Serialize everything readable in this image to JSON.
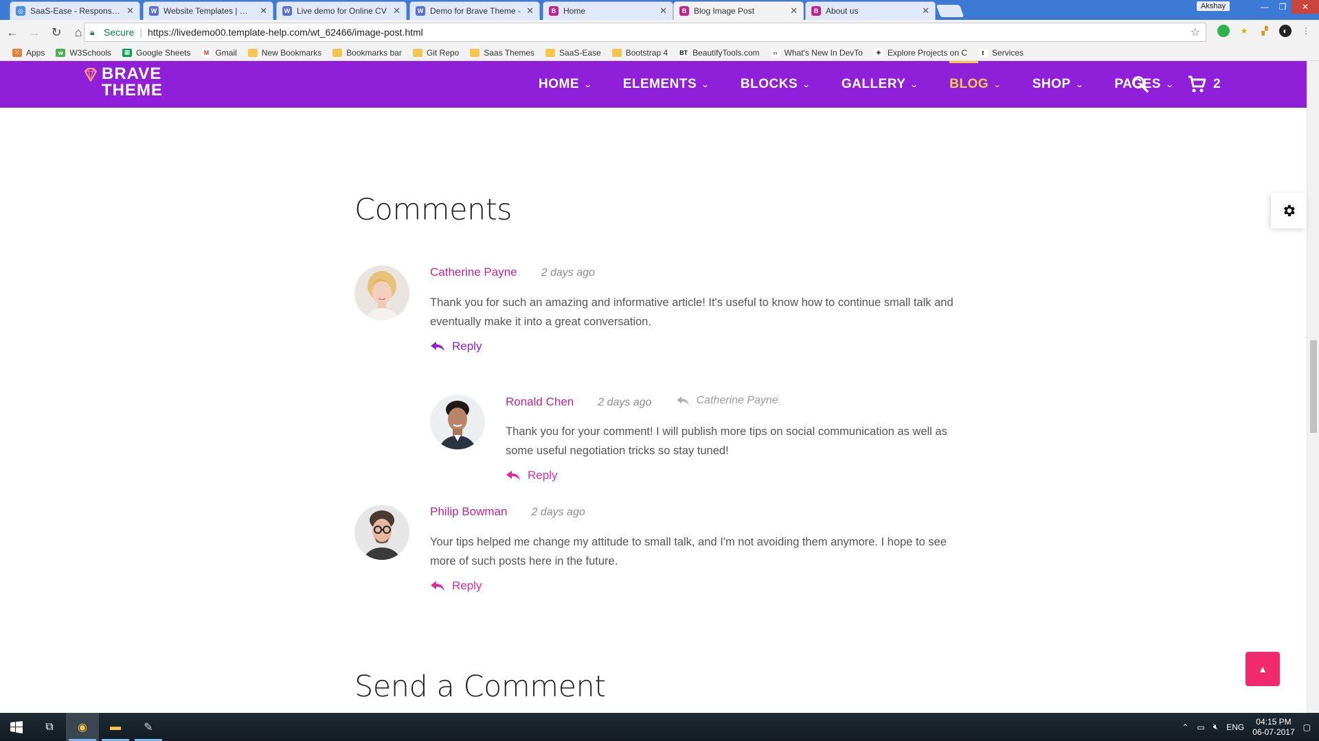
{
  "browser": {
    "tabs": [
      {
        "title": "SaaS-Ease - Responsive S",
        "color": "#4a8fe0",
        "glyph": "◎"
      },
      {
        "title": "Website Templates | Web",
        "color": "#5b6fd6",
        "glyph": "W"
      },
      {
        "title": "Live demo for Online CV",
        "color": "#5b6fd6",
        "glyph": "W"
      },
      {
        "title": "Demo for Brave Theme -",
        "color": "#5b6fd6",
        "glyph": "W"
      },
      {
        "title": "Home",
        "color": "#c2258f",
        "glyph": "B"
      },
      {
        "title": "Blog Image Post",
        "color": "#c2258f",
        "glyph": "B",
        "active": true
      },
      {
        "title": "About us",
        "color": "#c2258f",
        "glyph": "B"
      }
    ],
    "user": "Akshay",
    "address": {
      "secure_label": "Secure",
      "url": "https://livedemo00.template-help.com/wt_62466/image-post.html"
    },
    "bookmarks": [
      {
        "label": "Apps",
        "icon": "apps-grid-icon"
      },
      {
        "label": "W3Schools",
        "icon": "w3schools-icon"
      },
      {
        "label": "Google Sheets",
        "icon": "sheets-icon"
      },
      {
        "label": "Gmail",
        "icon": "gmail-icon"
      },
      {
        "label": "New Bookmarks",
        "icon": "folder-icon"
      },
      {
        "label": "Bookmarks bar",
        "icon": "folder-icon"
      },
      {
        "label": "Git Repo",
        "icon": "folder-icon"
      },
      {
        "label": "Saas Themes",
        "icon": "folder-icon"
      },
      {
        "label": "SaaS-Ease",
        "icon": "folder-icon"
      },
      {
        "label": "Bootstrap 4",
        "icon": "folder-icon"
      },
      {
        "label": "BeautifyTools.com",
        "icon": "bt-icon"
      },
      {
        "label": "What's New In DevTo",
        "icon": "devtools-icon"
      },
      {
        "label": "Explore Projects on C",
        "icon": "codepen-icon"
      },
      {
        "label": "Services",
        "icon": "tumblr-icon"
      }
    ]
  },
  "site": {
    "logo_line1": "BRAVE",
    "logo_line2": "THEME",
    "nav": [
      {
        "label": "HOME"
      },
      {
        "label": "ELEMENTS"
      },
      {
        "label": "BLOCKS"
      },
      {
        "label": "GALLERY"
      },
      {
        "label": "BLOG",
        "active": true
      },
      {
        "label": "SHOP"
      },
      {
        "label": "PAGES"
      }
    ],
    "cart_count": "2",
    "colors": {
      "brand": "#8f1fd8",
      "accent": "#ffc94a",
      "author": "#c2258f",
      "to_top": "#f02a6d"
    }
  },
  "comments_section": {
    "heading": "Comments",
    "comments": [
      {
        "author": "Catherine Payne",
        "time": "2 days ago",
        "text": "Thank you for such an amazing and informative article! It's useful to know how to continue small talk and eventually make it into a great conversation.",
        "reply_label": "Reply"
      },
      {
        "author": "Ronald Chen",
        "time": "2 days ago",
        "reply_to": "Catherine Payne",
        "text": "Thank you for your comment! I will publish more tips on social communication as well as some useful negotiation tricks so stay tuned!",
        "reply_label": "Reply"
      },
      {
        "author": "Philip Bowman",
        "time": "2 days ago",
        "text": "Your tips helped me change my attitude to small talk, and I'm not avoiding them anymore. I hope to see more of such posts here in the future.",
        "reply_label": "Reply"
      }
    ]
  },
  "send_comment": {
    "heading": "Send a Comment"
  },
  "taskbar": {
    "lang": "ENG",
    "time": "04:15 PM",
    "date": "06-07-2017"
  }
}
